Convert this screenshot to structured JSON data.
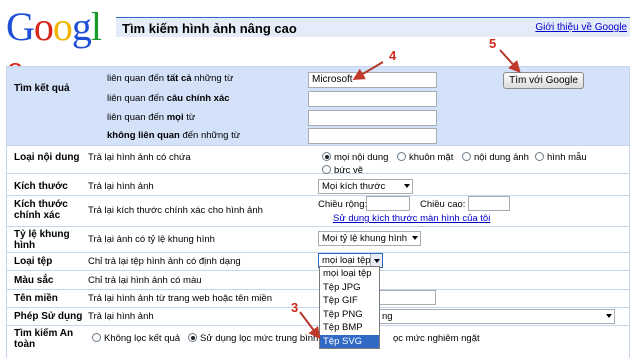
{
  "logo": {
    "letters": [
      "G",
      "o",
      "o",
      "g",
      "l",
      "e"
    ],
    "colors": [
      "#1f4fd6",
      "#d7261e",
      "#f0b400",
      "#1f4fd6",
      "#199d2a",
      "#d7261e"
    ]
  },
  "header": {
    "title": "Tìm kiếm hình ảnh nâng cao",
    "about_link": "Giới thiệu về Google"
  },
  "find_results": {
    "label": "Tìm kết quả",
    "rows": [
      {
        "prefix": "liên quan đến ",
        "bold": "tất cả",
        "suffix": " những từ",
        "value": "Microsoft"
      },
      {
        "prefix": "liên quan đến ",
        "bold": "câu chính xác",
        "suffix": "",
        "value": ""
      },
      {
        "prefix": "liên quan đến ",
        "bold": "mọi",
        "suffix": " từ",
        "value": ""
      },
      {
        "prefix": "",
        "bold": "không liên quan",
        "suffix": " đến những từ",
        "value": ""
      }
    ],
    "search_button": "Tìm với Google"
  },
  "content_type": {
    "label": "Loại nội dung",
    "desc": "Trả lại hình ảnh có chứa",
    "options": [
      "mọi nội dung",
      "khuôn mặt",
      "nội dung ảnh",
      "hình mẫu",
      "bức vẽ"
    ],
    "selected_index": 0
  },
  "size": {
    "label": "Kích thước",
    "desc": "Trả lại hình ảnh",
    "selected": "Mọi kích thước"
  },
  "exact_size": {
    "label_line1": "Kích thước",
    "label_line2": "chính xác",
    "desc": "Trả lại kích thước chính xác cho hình ảnh",
    "width_label": "Chiều rộng:",
    "height_label": "Chiều cao:",
    "screen_link": "Sử dụng kích thước màn hình của tôi"
  },
  "aspect_ratio": {
    "label_line1": "Tỷ lệ khung",
    "label_line2": "hình",
    "desc": "Trả lại ảnh có tỷ lệ khung hình",
    "selected": "Mọi tỷ lệ khung hình"
  },
  "file_type": {
    "label": "Loại tệp",
    "desc": "Chỉ trả lại tệp hình ảnh có định dạng",
    "selected": "mọi loại tệp",
    "options": [
      "mọi loại tệp",
      "Tệp JPG",
      "Tệp GIF",
      "Tệp PNG",
      "Tệp BMP",
      "Tệp SVG"
    ],
    "highlighted_index": 5
  },
  "color": {
    "label": "Màu sắc",
    "desc": "Chỉ trả lại hình ảnh có màu"
  },
  "domain": {
    "label": "Tên miền",
    "desc": "Trả lại hình ảnh từ trang web hoặc tên miền"
  },
  "usage_rights": {
    "label": "Phép Sử dụng",
    "desc": "Trả lại hình ảnh",
    "selected_tail": "ng"
  },
  "safesearch": {
    "label_line1": "Tìm kiếm An",
    "label_line2": "toàn",
    "options": [
      "Không lọc kết quả",
      "Sử dụng lọc mức trung bình",
      "ọc mức nghiêm ngặt"
    ],
    "selected_index": 1
  },
  "annotations": {
    "a4": "4",
    "a5": "5",
    "a3": "3",
    "color": "#d12a1f"
  }
}
